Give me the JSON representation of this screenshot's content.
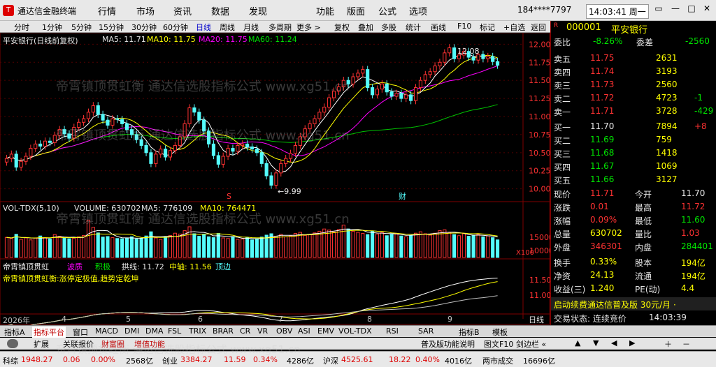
{
  "titlebar": {
    "logo": "T",
    "title": "通达信金融终端",
    "menu": [
      "行情",
      "市场",
      "资讯",
      "数据",
      "发现",
      "功能",
      "版面",
      "公式",
      "选项"
    ],
    "account": "184****7797",
    "clock": "14:03:41 周一",
    "win": [
      "▭",
      "—",
      "□",
      "✕"
    ]
  },
  "toolbar": [
    "分时",
    "1分钟",
    "5分钟",
    "15分钟",
    "30分钟",
    "60分钟",
    "日线",
    "周线",
    "月线",
    "多周期",
    "更多 >",
    "复权",
    "叠加",
    "多股",
    "统计",
    "画线",
    "F10",
    "标记",
    "+自选",
    "返回"
  ],
  "chart": {
    "title_line": "平安银行(日线前复权)",
    "ma5": "MA5: 11.71",
    "ma10": "MA10: 11.75",
    "ma20": "MA20: 11.75",
    "ma60": "MA60: 11.24",
    "high_mark": "12.08",
    "low_mark": "←9.99",
    "s_mark": "S",
    "cai_mark": "财",
    "price_ticks": [
      "12.00",
      "11.75",
      "11.50",
      "11.25",
      "11.00",
      "10.75",
      "10.50",
      "10.25",
      "10.00"
    ],
    "vol_title": "VOL-TDX(5,10)",
    "vol_value": "VOLUME: 630702",
    "vol_ma5": "MA5: 776109",
    "vol_ma10": "MA10: 764471",
    "vol_ticks": [
      "15000",
      "10000",
      "5000"
    ],
    "vol_unit": "X100",
    "ind_name": "帝霄镇顶贯虹",
    "ind_f1": "波质",
    "ind_f2": "积极",
    "ind_f3": "拱线: 11.72",
    "ind_f4": "中轴: 11.56",
    "ind_f5": "顶边",
    "ind_desc": "帝霄镇顶贯虹衡:涨停定极值,趋势定乾坤",
    "ind_ticks": [
      "11.50",
      "11.00"
    ],
    "dates": [
      "2026年",
      "4",
      "5",
      "6",
      "7",
      "8",
      "9"
    ],
    "period_label": "日线"
  },
  "chart_data": {
    "type": "candlestick",
    "y_price_range": [
      9.9,
      12.1
    ],
    "closes": [
      10.42,
      10.48,
      10.3,
      10.38,
      10.45,
      10.56,
      10.62,
      10.59,
      10.66,
      10.64,
      10.74,
      10.82,
      10.76,
      10.7,
      10.85,
      10.92,
      10.97,
      11.06,
      11.15,
      11.03,
      10.95,
      10.88,
      10.97,
      10.96,
      10.9,
      10.82,
      10.75,
      10.68,
      10.6,
      10.5,
      10.35,
      10.48,
      10.55,
      10.44,
      10.53,
      10.6,
      10.72,
      10.9,
      11.12,
      11.06,
      10.95,
      10.8,
      10.62,
      10.46,
      10.34,
      10.45,
      10.56,
      10.52,
      10.6,
      10.62,
      10.58,
      10.55,
      10.5,
      10.35,
      10.18,
      10.05,
      10.22,
      10.35,
      10.42,
      10.49,
      10.6,
      10.72,
      10.83,
      10.9,
      10.97,
      11.06,
      11.13,
      11.26,
      11.35,
      11.41,
      11.5,
      11.45,
      11.55,
      11.6,
      11.65,
      11.4,
      11.3,
      11.38,
      11.45,
      11.34,
      11.28,
      11.32,
      11.25,
      11.3,
      11.22,
      11.4,
      11.5,
      11.58,
      11.62,
      11.7,
      11.75,
      11.88,
      11.95,
      11.8,
      11.85,
      11.9,
      11.82,
      11.78,
      11.86,
      11.8,
      11.83,
      11.76,
      11.71
    ],
    "volumes": [
      7200,
      6800,
      8300,
      6500,
      7000,
      6300,
      6900,
      7700,
      7100,
      6600,
      8200,
      7600,
      7000,
      6700,
      6900,
      7400,
      7900,
      13400,
      10800,
      8800,
      7300,
      7500,
      7100,
      6800,
      6700,
      7000,
      7400,
      6600,
      6800,
      7700,
      9200,
      7000,
      6500,
      7300,
      7900,
      8700,
      8400,
      9600,
      11000,
      8500,
      7600,
      8200,
      7400,
      7100,
      8600,
      7000,
      6800,
      7500,
      6500,
      6600,
      7100,
      6300,
      6700,
      7300,
      8000,
      8500,
      7600,
      8300,
      7400,
      7800,
      8600,
      9000,
      7900,
      8200,
      8800,
      9400,
      10200,
      9800,
      9100,
      10000,
      11600,
      10200,
      9400,
      9000,
      8600,
      8200,
      9500,
      8400,
      8900,
      7800,
      8300,
      8600,
      7700,
      7400,
      7900,
      8700,
      9200,
      8500,
      8000,
      8700,
      9600,
      9900,
      8900,
      8200,
      7800,
      8500,
      7600,
      7900,
      8300,
      7400,
      7700,
      7100,
      6300
    ],
    "ylabel": "",
    "xlabel": "",
    "title": "平安银行(日线前复权)"
  },
  "quote": {
    "code": "000001",
    "name": "平安银行",
    "scroll_tag": "R",
    "wb_label": "委比",
    "wb": "-8.26%",
    "wc_label": "委差",
    "wc": "-2560",
    "asks": [
      {
        "l": "卖五",
        "p": "11.75",
        "v": "2631",
        "d": ""
      },
      {
        "l": "卖四",
        "p": "11.74",
        "v": "3193",
        "d": ""
      },
      {
        "l": "卖三",
        "p": "11.73",
        "v": "2560",
        "d": ""
      },
      {
        "l": "卖二",
        "p": "11.72",
        "v": "4723",
        "d": "-1"
      },
      {
        "l": "卖一",
        "p": "11.71",
        "v": "3728",
        "d": "-429"
      }
    ],
    "bids": [
      {
        "l": "买一",
        "p": "11.70",
        "v": "7894",
        "d": "+8"
      },
      {
        "l": "买二",
        "p": "11.69",
        "v": "759",
        "d": ""
      },
      {
        "l": "买三",
        "p": "11.68",
        "v": "1418",
        "d": ""
      },
      {
        "l": "买四",
        "p": "11.67",
        "v": "1069",
        "d": ""
      },
      {
        "l": "买五",
        "p": "11.66",
        "v": "3127",
        "d": ""
      }
    ],
    "stats": [
      [
        "现价",
        "11.71",
        "今开",
        "11.70"
      ],
      [
        "涨跌",
        "0.01",
        "最高",
        "11.72"
      ],
      [
        "涨幅",
        "0.09%",
        "最低",
        "11.60"
      ],
      [
        "总量",
        "630702",
        "量比",
        "1.03"
      ],
      [
        "外盘",
        "346301",
        "内盘",
        "284401"
      ]
    ],
    "stats2": [
      [
        "换手",
        "0.33%",
        "股本",
        "194亿"
      ],
      [
        "净资",
        "24.13",
        "流通",
        "194亿"
      ],
      [
        "收益(三)",
        "1.240",
        "PE(动)",
        "4.4"
      ]
    ],
    "promo": "启动续费通达信普及版 30元/月 ·",
    "trade_label": "交易状态: 连续竞价",
    "trade_time": "14:03:39"
  },
  "tabs1": [
    "指标A",
    "指标平台",
    "窗口",
    "MACD",
    "DMI",
    "DMA",
    "FSL",
    "TRIX",
    "BRAR",
    "CR",
    "VR",
    "OBV",
    "ASI",
    "EMV",
    "VOL-TDX",
    "RSI",
    "SAR",
    "指标B",
    "模板"
  ],
  "tabs2": [
    "扩展",
    "关联报价",
    "财富圈",
    "增值功能",
    "普及版功能说明",
    "图文F10 剑边栏 «"
  ],
  "status": {
    "sz_label": "科综",
    "sz_val": "1948.27",
    "sz_chg": "0.06",
    "sz_pct": "0.00%",
    "sz_amt": "2568亿",
    "cy_label": "创业",
    "cy_val": "3384.27",
    "cy_chg": "11.59",
    "cy_pct": "0.34%",
    "cy_amt": "4286亿",
    "hs_label": "沪深",
    "hs_val": "4525.61",
    "hs_chg": "18.22",
    "hs_pct": "0.40%",
    "hs_amt": "4016亿",
    "tot_label": "两市成交",
    "tot_amt": "16696亿"
  },
  "watermark": "帝霄镇顶贯虹衡 通达信选股指标公式 www.xg51.cn",
  "colors": {
    "up": "#ff3232",
    "down": "#54fcfc",
    "ma5": "#ffffff",
    "ma10": "#ffff00",
    "ma20": "#ff00ff",
    "ma60": "#00c000",
    "frame": "#800000"
  }
}
